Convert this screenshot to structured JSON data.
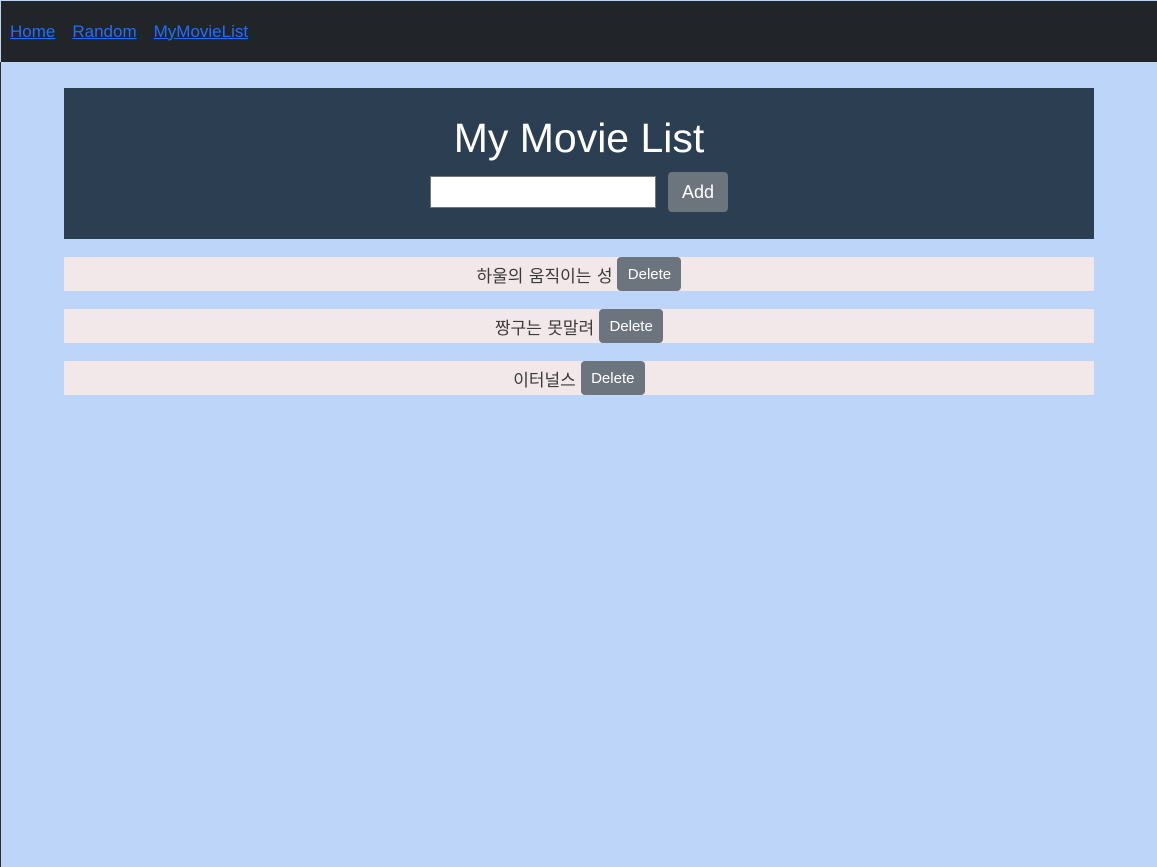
{
  "nav": {
    "links": [
      {
        "label": "Home"
      },
      {
        "label": "Random"
      },
      {
        "label": "MyMovieList"
      }
    ]
  },
  "header": {
    "title": "My Movie List",
    "input_value": "",
    "add_label": "Add"
  },
  "movies": [
    {
      "title": "하울의 움직이는 성",
      "delete_label": "Delete"
    },
    {
      "title": "짱구는 못말려",
      "delete_label": "Delete"
    },
    {
      "title": "이터널스",
      "delete_label": "Delete"
    }
  ],
  "colors": {
    "page_bg": "#bcd5f8",
    "nav_bg": "#212529",
    "header_bg": "#2c3e51",
    "item_bg": "#f3e8e9",
    "button_bg": "#6c757d",
    "link": "#1f6fff"
  }
}
